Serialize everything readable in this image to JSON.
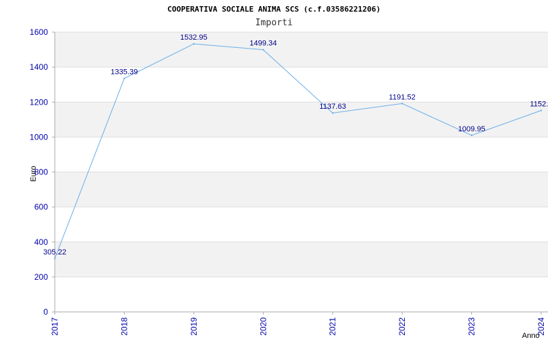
{
  "chart_data": {
    "type": "line",
    "title": "COOPERATIVA SOCIALE ANIMA SCS (c.f.03586221206)",
    "subtitle": "Importi",
    "xlabel": "Anno",
    "ylabel": "Euro",
    "categories": [
      "2017",
      "2018",
      "2019",
      "2020",
      "2021",
      "2022",
      "2023",
      "2024"
    ],
    "series": [
      {
        "values": [
          305.22,
          1335.39,
          1532.95,
          1499.34,
          1137.63,
          1191.52,
          1009.95,
          1152.0
        ],
        "labels": [
          "305.22",
          "1335.39",
          "1532.95",
          "1499.34",
          "1137.63",
          "1191.52",
          "1009.95",
          "1152.0"
        ]
      }
    ],
    "ylim": [
      0,
      1600
    ],
    "yticks": [
      "0",
      "200",
      "400",
      "600",
      "800",
      "1000",
      "1200",
      "1400",
      "1600"
    ],
    "grid": true,
    "colors": {
      "line": "#6aaee8",
      "band": "#f2f2f2",
      "gridline": "#dddddd",
      "tick": "#0000aa"
    }
  }
}
